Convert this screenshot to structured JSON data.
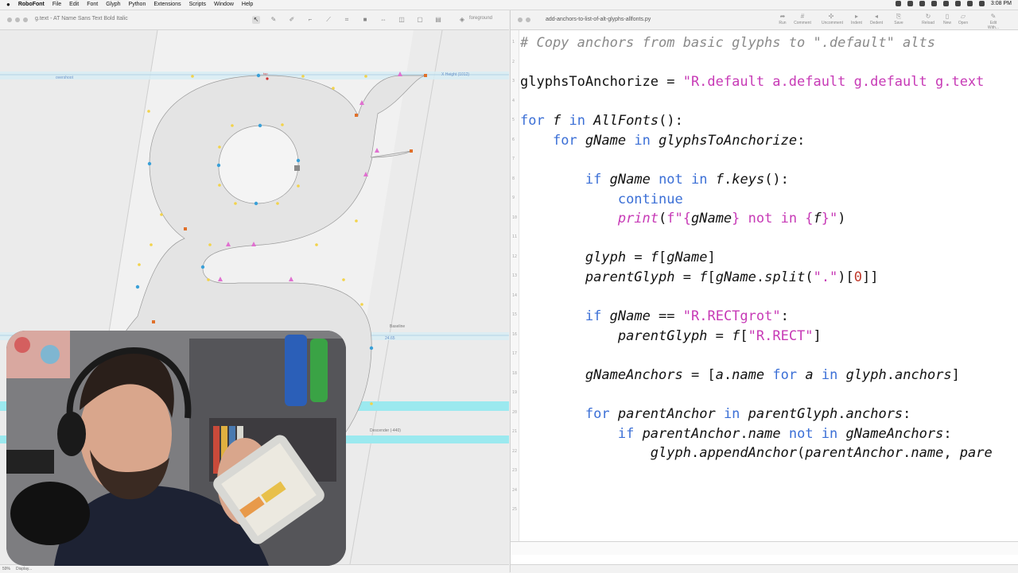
{
  "menubar": {
    "app_name": "RoboFont",
    "items": [
      "File",
      "Edit",
      "Font",
      "Glyph",
      "Python",
      "Extensions",
      "Scripts",
      "Window",
      "Help"
    ],
    "clock": "3:08 PM"
  },
  "glyph_window": {
    "title": "g.text - AT Name Sans Text Bold Italic",
    "layer": "foreground",
    "guides": {
      "overshoot": "overshoot",
      "top_anchor": "top",
      "xheight": "X Height (1012)",
      "baseline": "Baseline",
      "baseline_value": "24.65",
      "descender": "Descender (-440)"
    },
    "status": {
      "zoom": "59%",
      "display": "Display..."
    }
  },
  "editor": {
    "filename": "add-anchors-to-list-of-alt-glyphs-allfonts.py",
    "toolbar": [
      "Run",
      "Comment",
      "Uncomment",
      "Indent",
      "Dedent",
      "Save",
      "Reload",
      "New",
      "Open",
      "Edit With..."
    ],
    "line_numbers": [
      "1",
      "2",
      "3",
      "4",
      "5",
      "6",
      "7",
      "8",
      "9",
      "10",
      "11",
      "12",
      "13",
      "14",
      "15",
      "16",
      "17",
      "18",
      "19",
      "20",
      "21",
      "22",
      "23",
      "24",
      "25"
    ]
  },
  "colors": {
    "keyword": "#3b6fd6",
    "string": "#c73ab6",
    "comment": "#8a8a8a",
    "guide_cyan": "#9be9ef"
  }
}
